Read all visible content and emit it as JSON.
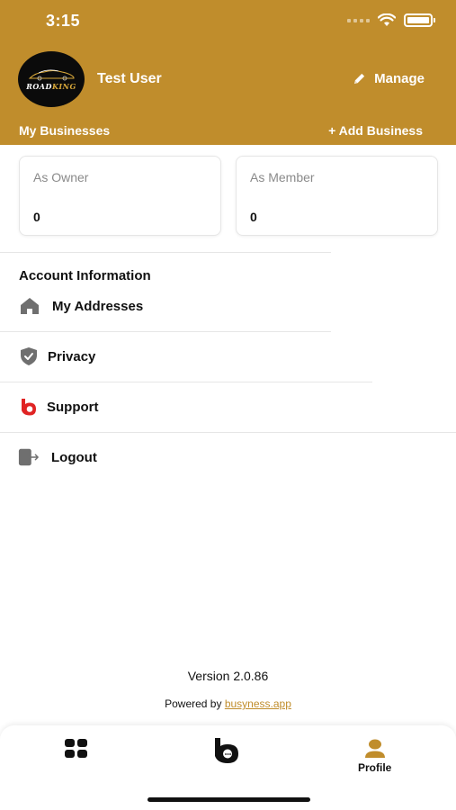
{
  "status_bar": {
    "time": "3:15",
    "signal_icon": "signal-dots-icon",
    "wifi_icon": "wifi-icon",
    "battery_icon": "battery-icon"
  },
  "header": {
    "avatar": {
      "brand_left": "ROAD",
      "brand_right": "KING"
    },
    "user_name": "Test User",
    "manage_label": "Manage",
    "manage_icon": "pencil-icon",
    "section_title": "My Businesses",
    "add_business_label": "+ Add Business"
  },
  "business_counts": {
    "owner": {
      "label": "As Owner",
      "value": "0"
    },
    "member": {
      "label": "As Member",
      "value": "0"
    }
  },
  "account": {
    "title": "Account Information",
    "items": [
      {
        "label": "My Addresses",
        "icon": "home-icon"
      },
      {
        "label": "Privacy",
        "icon": "shield-check-icon"
      },
      {
        "label": "Support",
        "icon": "busyness-logo-icon"
      },
      {
        "label": "Logout",
        "icon": "logout-icon"
      }
    ]
  },
  "footer": {
    "version": "Version 2.0.86",
    "powered_by_prefix": "Powered by ",
    "powered_by_link": "busyness.app"
  },
  "tabbar": {
    "tabs": [
      {
        "icon": "grid-icon",
        "label": ""
      },
      {
        "icon": "busyness-logo-icon",
        "label": ""
      },
      {
        "icon": "profile-icon",
        "label": "Profile"
      }
    ],
    "active_color": "#c08d2c"
  },
  "colors": {
    "brand": "#c08d2c",
    "support_red": "#e02424",
    "icon_gray": "#6f6f6f"
  }
}
